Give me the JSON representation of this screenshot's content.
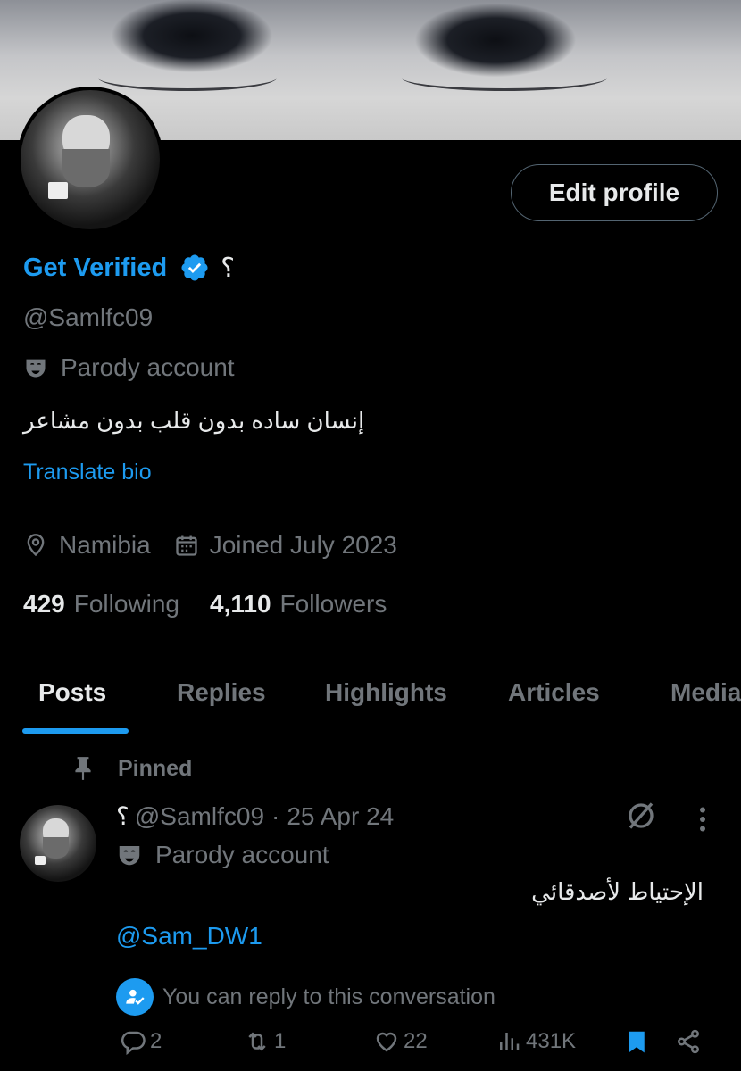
{
  "profile": {
    "name": "Get Verified",
    "name_suffix": "؟",
    "handle": "@Samlfc09",
    "parody_label": "Parody account",
    "bio": "إنسان ساده بدون قلب بدون مشاعر",
    "translate_label": "Translate bio",
    "location": "Namibia",
    "joined": "Joined July 2023",
    "following_count": "429",
    "following_label": "Following",
    "followers_count": "4,110",
    "followers_label": "Followers",
    "edit_button": "Edit profile",
    "icons": [
      "verified-badge-icon",
      "mask-icon",
      "location-pin-icon",
      "calendar-icon"
    ]
  },
  "tabs": [
    {
      "label": "Posts",
      "active": true
    },
    {
      "label": "Replies",
      "active": false
    },
    {
      "label": "Highlights",
      "active": false
    },
    {
      "label": "Articles",
      "active": false
    },
    {
      "label": "Media",
      "active": false
    }
  ],
  "post": {
    "pinned_label": "Pinned",
    "author_prefix": "؟",
    "handle": "@Samlfc09",
    "separator": "·",
    "date": "25 Apr 24",
    "parody_label": "Parody account",
    "text": "الإحتياط لأصدقائي",
    "mention": "@Sam_DW1",
    "reply_note": "You can reply to this conversation",
    "replies": "2",
    "reposts": "1",
    "likes": "22",
    "views": "431K",
    "bookmarked": true
  },
  "colors": {
    "accent": "#1d9bf0",
    "text_primary": "#e7e9ea",
    "text_secondary": "#71767b",
    "background": "#000000"
  }
}
